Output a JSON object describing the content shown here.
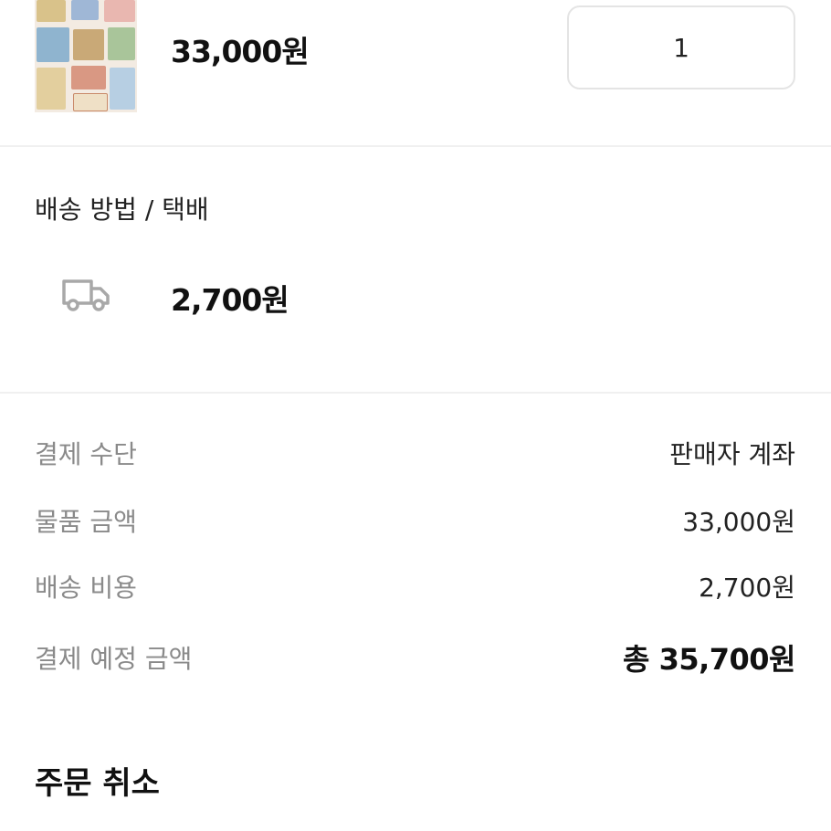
{
  "product": {
    "image": "product-thumbnail",
    "price": "33,000원",
    "quantity": "1"
  },
  "shipping": {
    "title": "배송 방법 / 택배",
    "icon": "truck-icon",
    "price": "2,700원"
  },
  "payment": {
    "rows": [
      {
        "label": "결제 수단",
        "value": "판매자 계좌"
      },
      {
        "label": "물품 금액",
        "value": "33,000원"
      },
      {
        "label": "배송 비용",
        "value": "2,700원"
      },
      {
        "label": "결제 예정 금액",
        "value": "총 35,700원"
      }
    ]
  },
  "cancel_label": "주문 취소"
}
